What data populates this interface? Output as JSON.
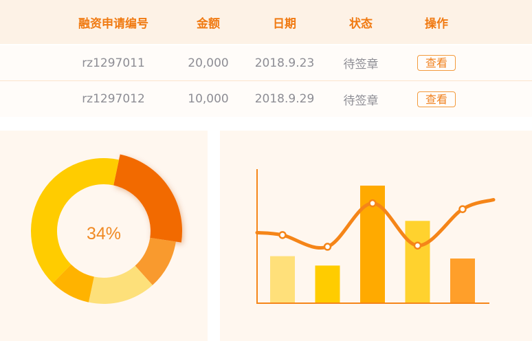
{
  "table": {
    "headers": [
      "融资申请编号",
      "金额",
      "日期",
      "状态",
      "操作"
    ],
    "rows": [
      {
        "id": "rz1297011",
        "amount": "20,000",
        "date": "2018.9.23",
        "status": "待签章",
        "action": "查看"
      },
      {
        "id": "rz1297012",
        "amount": "10,000",
        "date": "2018.9.29",
        "status": "待签章",
        "action": "查看"
      }
    ]
  },
  "colors": {
    "accent": "#f07a12",
    "header_bg": "#fdf2e6",
    "panel_bg": "#fff7ef",
    "text_muted": "#8d8d94"
  },
  "donut": {
    "label": "34%",
    "chart_data": {
      "type": "pie",
      "values": [
        24,
        11,
        15,
        9,
        41
      ],
      "colors": [
        "#f26b00",
        "#f99a2e",
        "#fde07a",
        "#ffb300",
        "#ffcc00"
      ]
    }
  },
  "combo": {
    "chart_data": {
      "type": "bar",
      "values": [
        40,
        32,
        100,
        70,
        38
      ],
      "line_values": [
        58,
        48,
        85,
        49,
        80
      ],
      "line_start": 60,
      "line_end": 88,
      "ylim": [
        0,
        100
      ],
      "bar_colors": [
        "#ffe07a",
        "#ffcc00",
        "#ffaa00",
        "#ffd22e",
        "#ff9f2a"
      ],
      "line_color": "#f58518",
      "axis_color": "#f58518"
    }
  }
}
